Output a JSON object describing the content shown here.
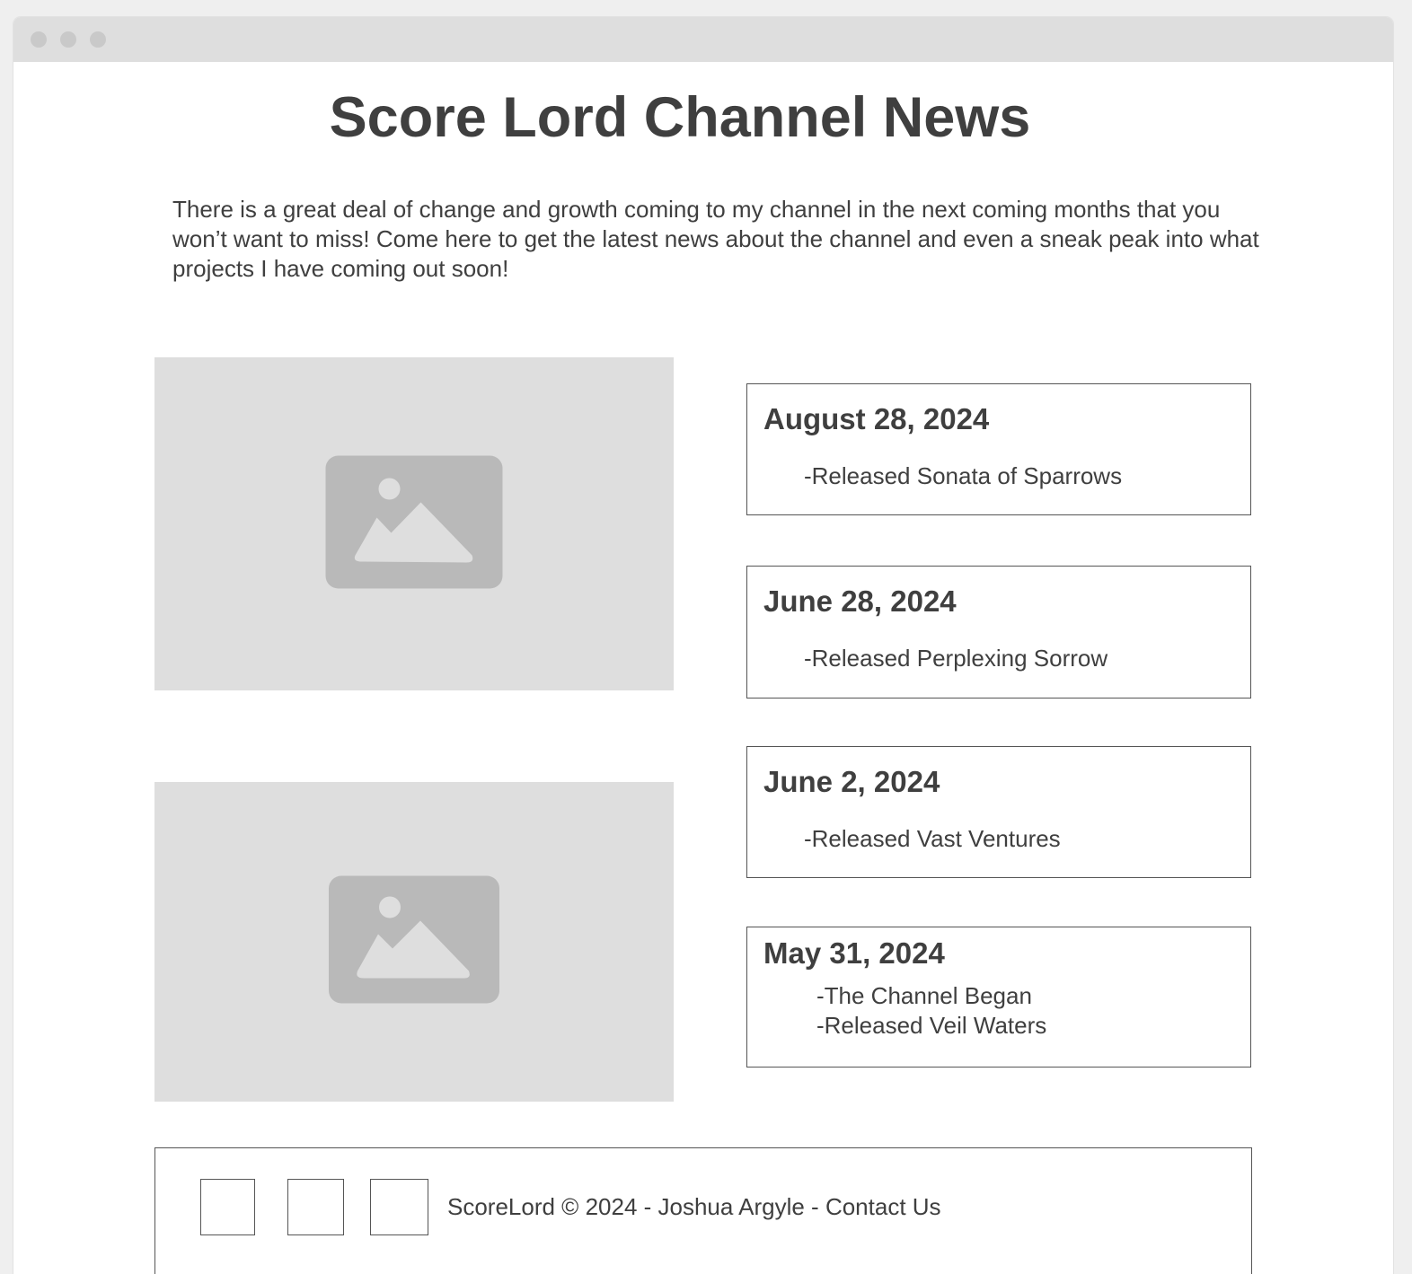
{
  "page": {
    "title": "Score Lord Channel News",
    "intro": "There is a great deal of change and growth coming to my channel in the next coming months that you won’t want to miss! Come here to get the latest news about the channel and even a sneak peak into what projects I have coming out soon!"
  },
  "images": [
    {
      "icon": "image-placeholder-icon"
    },
    {
      "icon": "image-placeholder-icon"
    }
  ],
  "news": [
    {
      "date": "August 28, 2024",
      "items": [
        "-Released Sonata of Sparrows"
      ]
    },
    {
      "date": "June 28, 2024",
      "items": [
        "-Released Perplexing Sorrow"
      ]
    },
    {
      "date": "June 2, 2024",
      "items": [
        "-Released Vast Ventures"
      ]
    },
    {
      "date": "May 31, 2024",
      "items": [
        "-The Channel Began",
        "-Released Veil Waters"
      ]
    }
  ],
  "footer": {
    "text": "ScoreLord © 2024 - Joshua Argyle - Contact Us"
  },
  "colors": {
    "text": "#3f3f3f",
    "placeholder_bg": "#dedede",
    "placeholder_icon": "#b9b9b9",
    "border": "#555555",
    "titlebar": "#dedede"
  }
}
